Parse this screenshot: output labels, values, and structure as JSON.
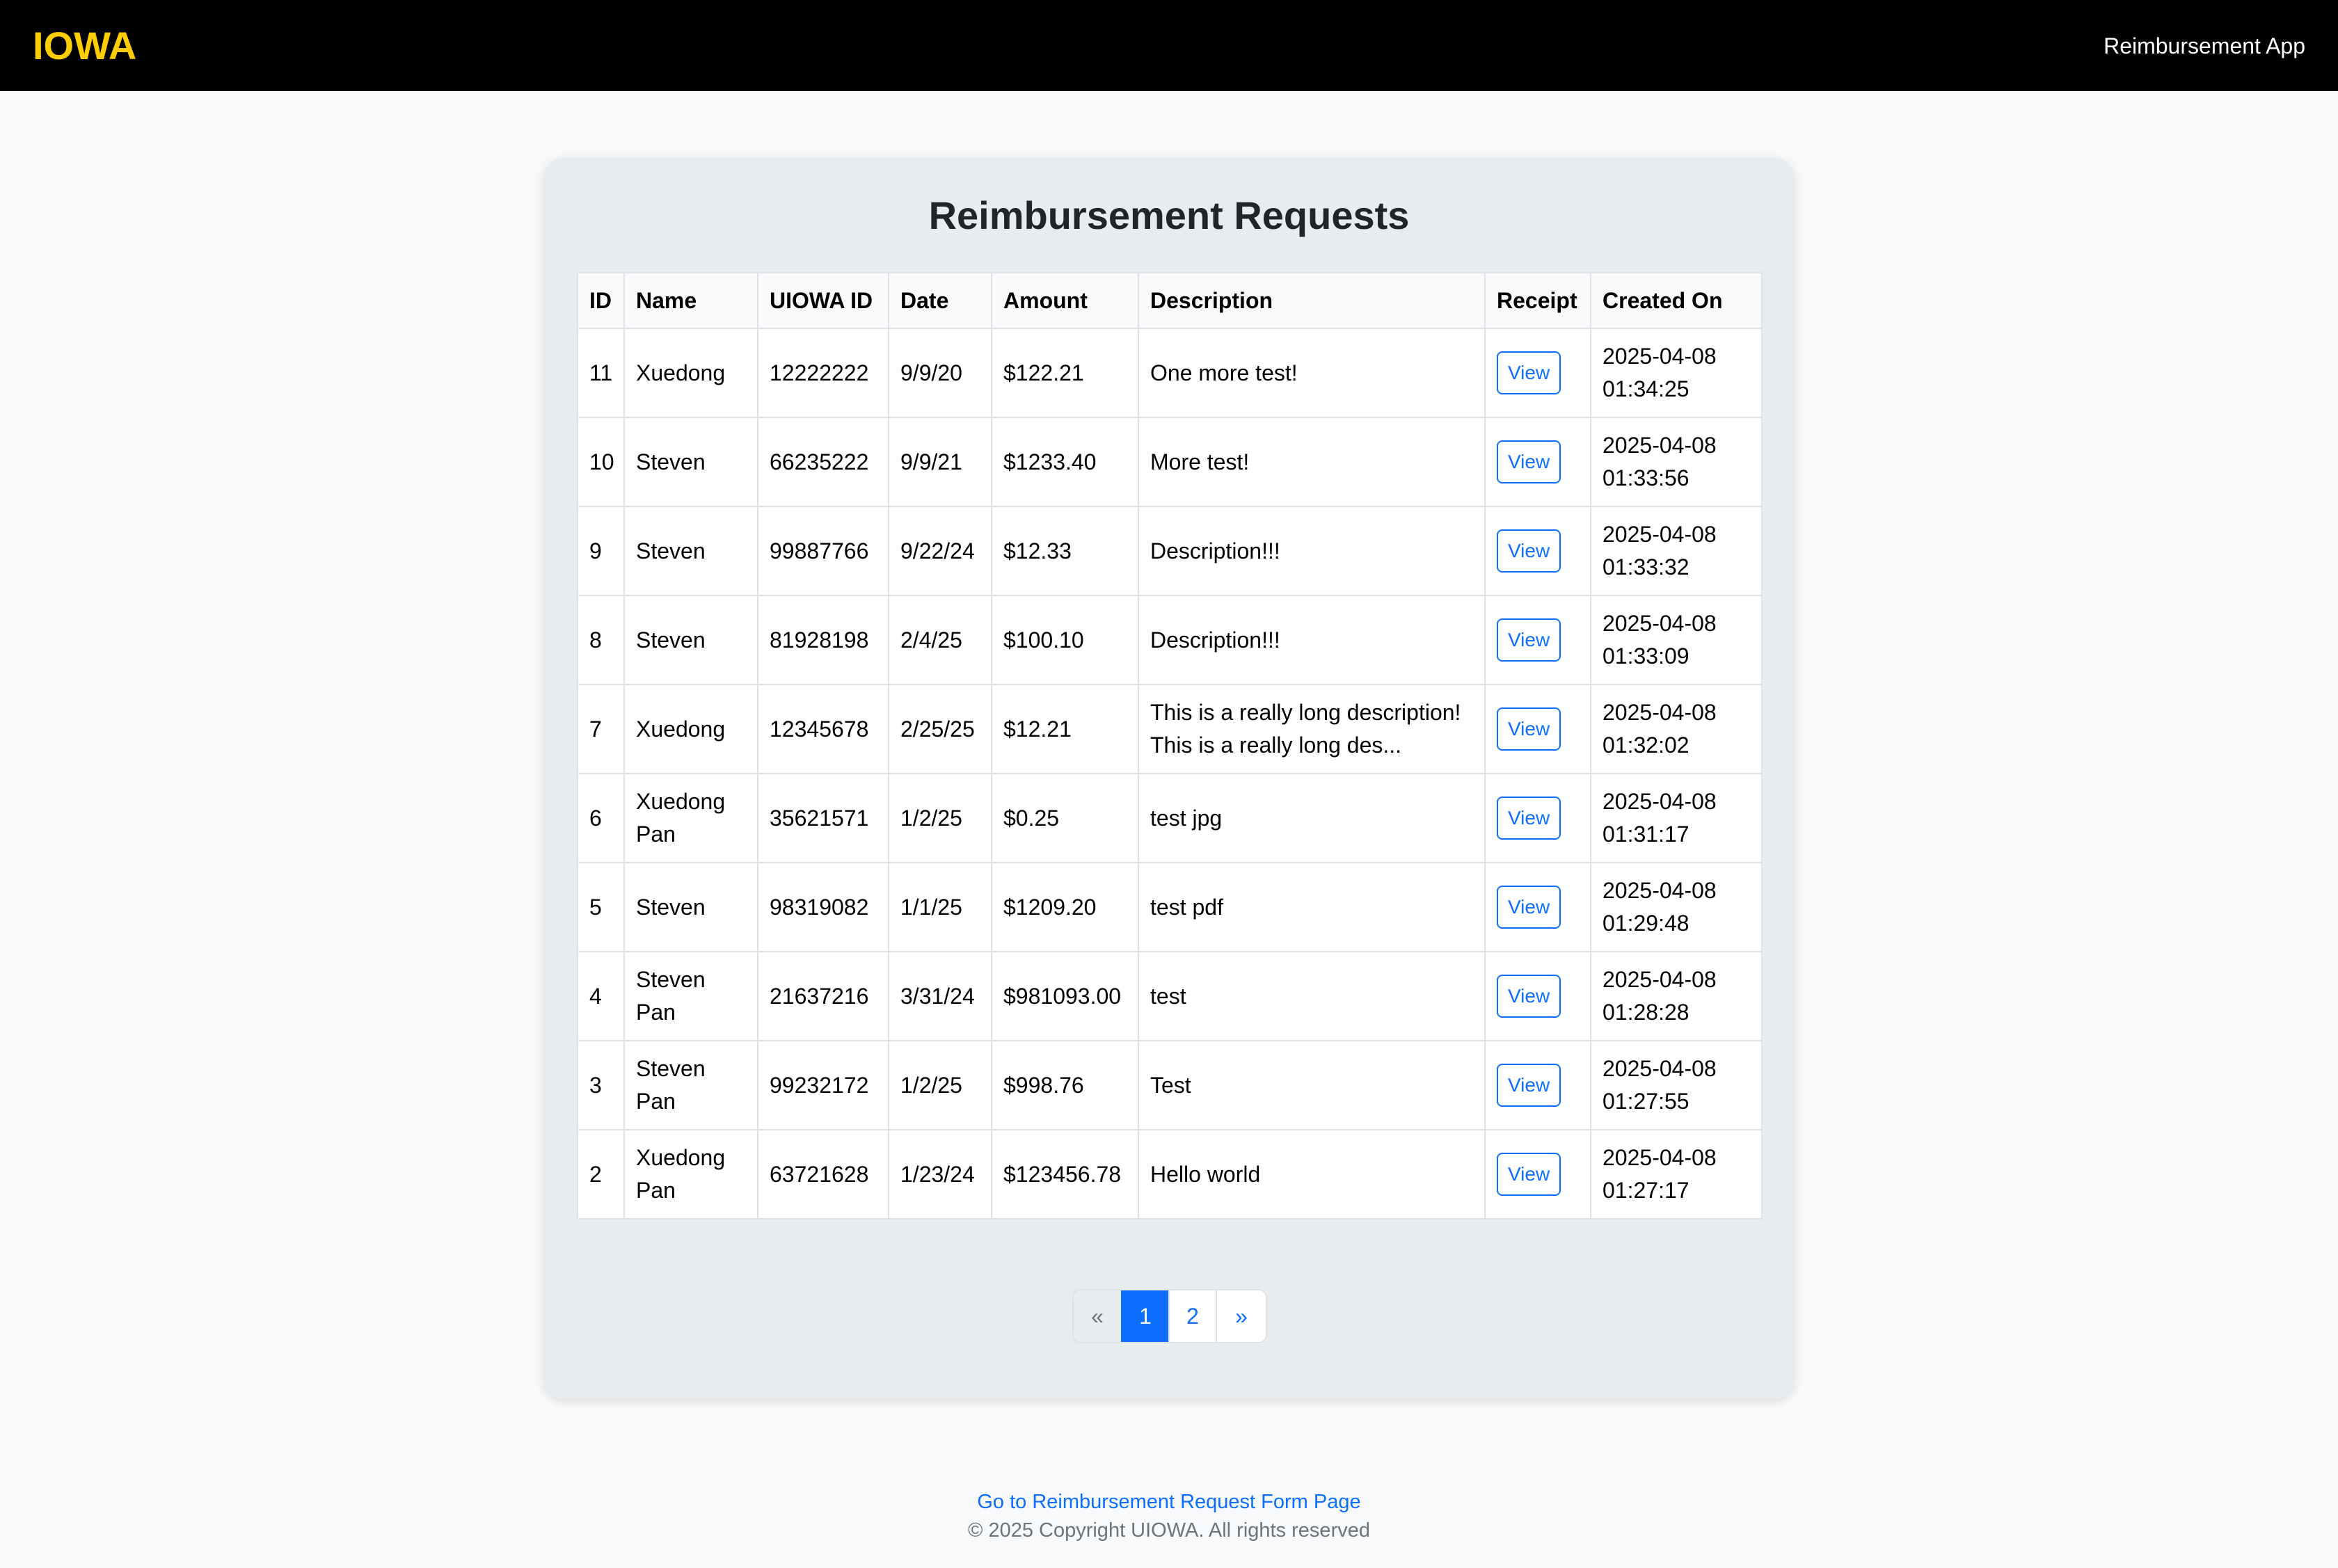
{
  "header": {
    "brand": "IOWA",
    "app_title": "Reimbursement App"
  },
  "main": {
    "title": "Reimbursement Requests",
    "columns": [
      "ID",
      "Name",
      "UIOWA ID",
      "Date",
      "Amount",
      "Description",
      "Receipt",
      "Created On"
    ],
    "view_label": "View",
    "rows": [
      {
        "id": "11",
        "name": "Xuedong",
        "uiowa_id": "12222222",
        "date": "9/9/20",
        "amount": "$122.21",
        "description": "One more test!",
        "created_date": "2025-04-08",
        "created_time": "01:34:25"
      },
      {
        "id": "10",
        "name": "Steven",
        "uiowa_id": "66235222",
        "date": "9/9/21",
        "amount": "$1233.40",
        "description": "More test!",
        "created_date": "2025-04-08",
        "created_time": "01:33:56"
      },
      {
        "id": "9",
        "name": "Steven",
        "uiowa_id": "99887766",
        "date": "9/22/24",
        "amount": "$12.33",
        "description": "Description!!!",
        "created_date": "2025-04-08",
        "created_time": "01:33:32"
      },
      {
        "id": "8",
        "name": "Steven",
        "uiowa_id": "81928198",
        "date": "2/4/25",
        "amount": "$100.10",
        "description": "Description!!!",
        "created_date": "2025-04-08",
        "created_time": "01:33:09"
      },
      {
        "id": "7",
        "name": "Xuedong",
        "uiowa_id": "12345678",
        "date": "2/25/25",
        "amount": "$12.21",
        "description": "This is a really long description! This is a really long des...",
        "created_date": "2025-04-08",
        "created_time": "01:32:02"
      },
      {
        "id": "6",
        "name": "Xuedong Pan",
        "uiowa_id": "35621571",
        "date": "1/2/25",
        "amount": "$0.25",
        "description": "test jpg",
        "created_date": "2025-04-08",
        "created_time": "01:31:17"
      },
      {
        "id": "5",
        "name": "Steven",
        "uiowa_id": "98319082",
        "date": "1/1/25",
        "amount": "$1209.20",
        "description": "test pdf",
        "created_date": "2025-04-08",
        "created_time": "01:29:48"
      },
      {
        "id": "4",
        "name": "Steven Pan",
        "uiowa_id": "21637216",
        "date": "3/31/24",
        "amount": "$981093.00",
        "description": "test",
        "created_date": "2025-04-08",
        "created_time": "01:28:28"
      },
      {
        "id": "3",
        "name": "Steven Pan",
        "uiowa_id": "99232172",
        "date": "1/2/25",
        "amount": "$998.76",
        "description": "Test",
        "created_date": "2025-04-08",
        "created_time": "01:27:55"
      },
      {
        "id": "2",
        "name": "Xuedong Pan",
        "uiowa_id": "63721628",
        "date": "1/23/24",
        "amount": "$123456.78",
        "description": "Hello world",
        "created_date": "2025-04-08",
        "created_time": "01:27:17"
      }
    ]
  },
  "pagination": {
    "prev": "«",
    "pages": [
      "1",
      "2"
    ],
    "active_page": "1",
    "next": "»"
  },
  "footer": {
    "form_link": "Go to Reimbursement Request Form Page",
    "copyright": "© 2025 Copyright UIOWA. All rights reserved"
  },
  "colors": {
    "brand": "#FFCD00",
    "primary": "#0d6efd",
    "header_bg": "#000000"
  }
}
